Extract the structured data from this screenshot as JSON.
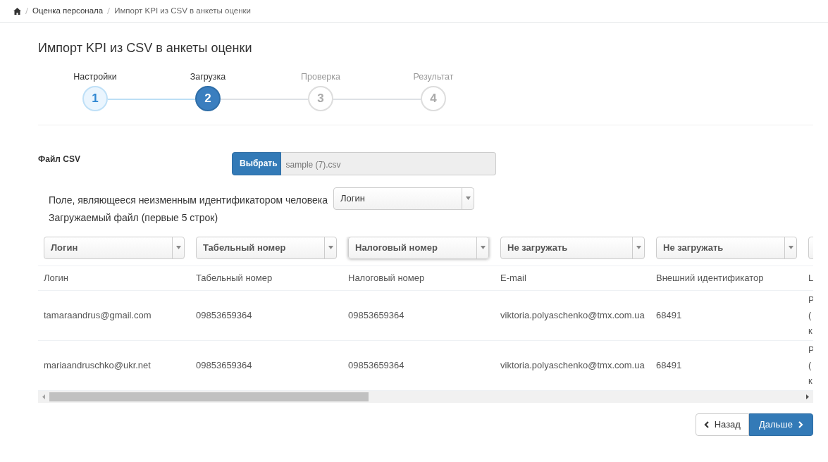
{
  "breadcrumb": [
    "Оценка персонала",
    "Импорт KPI из CSV в анкеты оценки"
  ],
  "title": "Импорт KPI из CSV в анкеты оценки",
  "steps": [
    {
      "label": "Настройки",
      "number": "1",
      "completed": true,
      "selected": false
    },
    {
      "label": "Загрузка",
      "number": "2",
      "completed": false,
      "selected": true
    },
    {
      "label": "Проверка",
      "number": "3",
      "completed": false,
      "selected": false
    },
    {
      "label": "Результат",
      "number": "4",
      "completed": false,
      "selected": false
    }
  ],
  "file": {
    "label": "Файл CSV",
    "button": "Выбрать",
    "value": "sample (7).csv"
  },
  "key_field": {
    "label": "Поле, являющееся неизменным идентификатором человека",
    "value": "Логин"
  },
  "preview_label": "Загружаемый файл (первые 5 строк)",
  "mapping": [
    {
      "value": "Логин",
      "focused": false
    },
    {
      "value": "Табельный номер",
      "focused": false
    },
    {
      "value": "Налоговый номер",
      "focused": true
    },
    {
      "value": "Не загружать",
      "focused": false
    },
    {
      "value": "Не загружать",
      "focused": false
    },
    {
      "focused": false
    }
  ],
  "table": {
    "columns": [
      "Логин",
      "Табельный номер",
      "Налоговый номер",
      "E-mail",
      "Внешний идентификатор",
      "L"
    ],
    "rows": [
      [
        "tamaraandrus@gmail.com",
        "09853659364",
        "09853659364",
        "viktoria.polyaschenko@tmx.com.ua",
        "68491",
        [
          "Р",
          "(",
          "к"
        ]
      ],
      [
        "mariaandruschko@ukr.net",
        "09853659364",
        "09853659364",
        "viktoria.polyaschenko@tmx.com.ua",
        "68491",
        [
          "Р",
          "(",
          "к"
        ]
      ]
    ]
  },
  "buttons": {
    "back": "Назад",
    "next": "Дальше"
  }
}
